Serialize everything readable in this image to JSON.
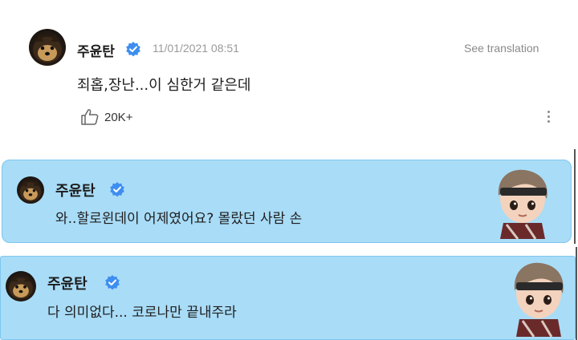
{
  "post": {
    "username": "주윤탄",
    "date": "11/01/2021 08:51",
    "see_translation": "See translation",
    "message": "죄홉,장난...이 심한거 같은데",
    "likes": "20K+"
  },
  "replies": [
    {
      "username": "주윤탄",
      "message": "와..할로윈데이 어제였어요? 몰랐던 사람 손"
    },
    {
      "username": "주윤탄",
      "message": "다 의미없다... 코로나만 끝내주라"
    }
  ],
  "colors": {
    "card_bg": "#a9dcf7",
    "card_border": "#7fc6ee",
    "verified_badge": "#3d8ef0"
  },
  "icons": [
    "verified-badge-icon",
    "thumbs-up-icon",
    "more-options-icon"
  ]
}
